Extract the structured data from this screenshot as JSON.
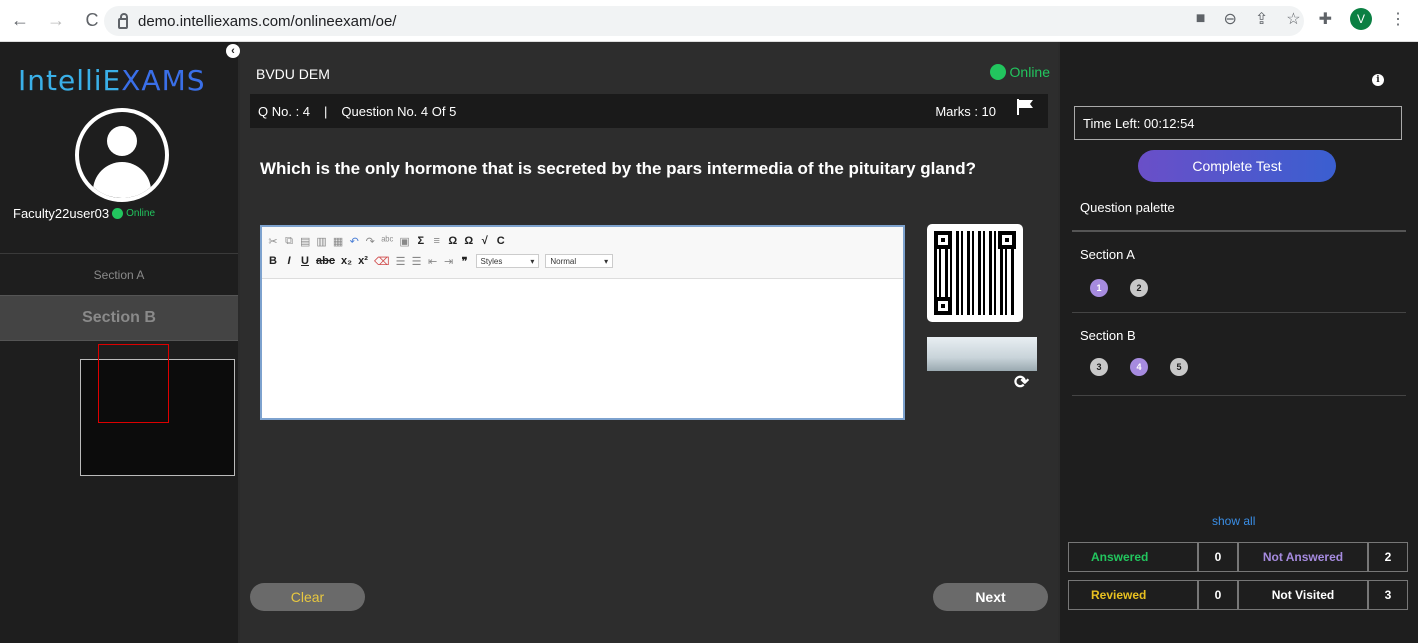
{
  "browser": {
    "url": "demo.intelliexams.com/onlineexam/oe/",
    "avatar_letter": "V"
  },
  "sidebar": {
    "logo_part1": "IntelliE",
    "logo_part2": "XAMS",
    "username": "Faculty22user03",
    "online_label": "Online",
    "sections": [
      "Section A",
      "Section B"
    ],
    "active_section": "Section B"
  },
  "main": {
    "exam_title": "BVDU DEM",
    "status_label": "Online",
    "q_no_label": "Q No. : 4",
    "separator": "|",
    "question_count_label": "Question No. 4 Of 5",
    "marks_label": "Marks : 10",
    "question_text": "Which is the only hormone that is secreted by the pars intermedia of the pituitary gland?",
    "editor": {
      "styles_label": "Styles",
      "format_label": "Normal"
    },
    "clear_label": "Clear",
    "next_label": "Next"
  },
  "right": {
    "time_left": "Time Left: 00:12:54",
    "complete_label": "Complete Test",
    "palette_title": "Question palette",
    "sections": [
      {
        "name": "Section A",
        "questions": [
          {
            "n": "1",
            "state": "current"
          },
          {
            "n": "2",
            "state": "not-visited"
          }
        ]
      },
      {
        "name": "Section B",
        "questions": [
          {
            "n": "3",
            "state": "not-visited"
          },
          {
            "n": "4",
            "state": "current"
          },
          {
            "n": "5",
            "state": "not-visited"
          }
        ]
      }
    ],
    "show_all": "show all",
    "legend": {
      "answered_label": "Answered",
      "answered_count": "0",
      "not_answered_label": "Not Answered",
      "not_answered_count": "2",
      "reviewed_label": "Reviewed",
      "reviewed_count": "0",
      "not_visited_label": "Not Visited",
      "not_visited_count": "3"
    },
    "colors": {
      "answered": "#22c55e",
      "not_answered": "#a68bdf",
      "reviewed": "#e8c020",
      "not_visited": "#ffffff"
    }
  }
}
